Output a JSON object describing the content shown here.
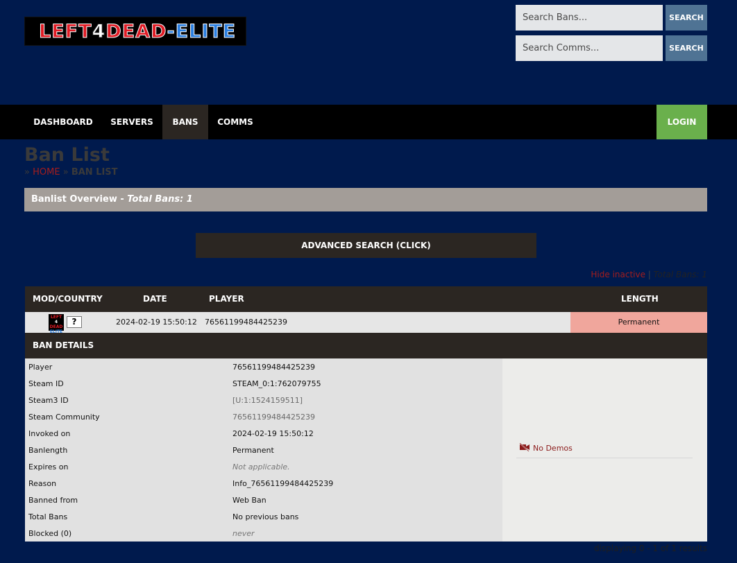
{
  "logo": {
    "part1": "LEFT",
    "part2": "4",
    "part3": "DEAD",
    "part4": "-ELITE"
  },
  "search": {
    "bans_placeholder": "Search Bans...",
    "bans_button": "SEARCH",
    "comms_placeholder": "Search Comms...",
    "comms_button": "SEARCH"
  },
  "nav": {
    "items": [
      {
        "label": "DASHBOARD"
      },
      {
        "label": "SERVERS"
      },
      {
        "label": "BANS"
      },
      {
        "label": "COMMS"
      }
    ],
    "active": "BANS",
    "login": "LOGIN"
  },
  "page": {
    "title": "Ban List",
    "breadcrumb": {
      "sep": "»",
      "home": "HOME",
      "current": "BAN LIST"
    }
  },
  "overview": {
    "label": "Banlist Overview",
    "dash": " - ",
    "total": "Total Bans: 1"
  },
  "advanced_search": "ADVANCED SEARCH (CLICK)",
  "filter": {
    "hide_inactive": "Hide inactive",
    "pipe": " | ",
    "total": "Total Bans: 1"
  },
  "table": {
    "headers": {
      "mod_country": "MOD/COUNTRY",
      "date": "DATE",
      "player": "PLAYER",
      "length": "LENGTH"
    },
    "row": {
      "mod_icon": {
        "l1": "LEFT",
        "l2": "4",
        "l3": "DEAD",
        "l4": "ELITE"
      },
      "flag": "?",
      "date": "2024-02-19 15:50:12",
      "player": "76561199484425239",
      "length": "Permanent"
    }
  },
  "details": {
    "title": "BAN DETAILS",
    "rows": [
      {
        "key": "Player",
        "value": "76561199484425239"
      },
      {
        "key": "Steam ID",
        "value": "STEAM_0:1:762079755"
      },
      {
        "key": "Steam3 ID",
        "value": "[U:1:1524159511]"
      },
      {
        "key": "Steam Community",
        "value": "76561199484425239"
      },
      {
        "key": "Invoked on",
        "value": "2024-02-19 15:50:12"
      },
      {
        "key": "Banlength",
        "value": "Permanent"
      },
      {
        "key": "Expires on",
        "value": "Not applicable."
      },
      {
        "key": "Reason",
        "value": "Info_76561199484425239"
      },
      {
        "key": "Banned from",
        "value": "Web Ban"
      },
      {
        "key": "Total Bans",
        "value": "No previous bans"
      },
      {
        "key": "Blocked (0)",
        "value": "never"
      }
    ],
    "demos": "No Demos"
  },
  "footer": "displaying 0 - 1 of 1 results",
  "colors": {
    "background": "#001a4d",
    "nav": "#000000",
    "active_nav": "#2b2622",
    "login": "#6ab04c",
    "search_button": "#4f7394",
    "overview": "#a39d98",
    "permanent": "#f0a69c",
    "link_red": "#a31d1d"
  },
  "icons": {
    "demo": "no-video-icon"
  }
}
